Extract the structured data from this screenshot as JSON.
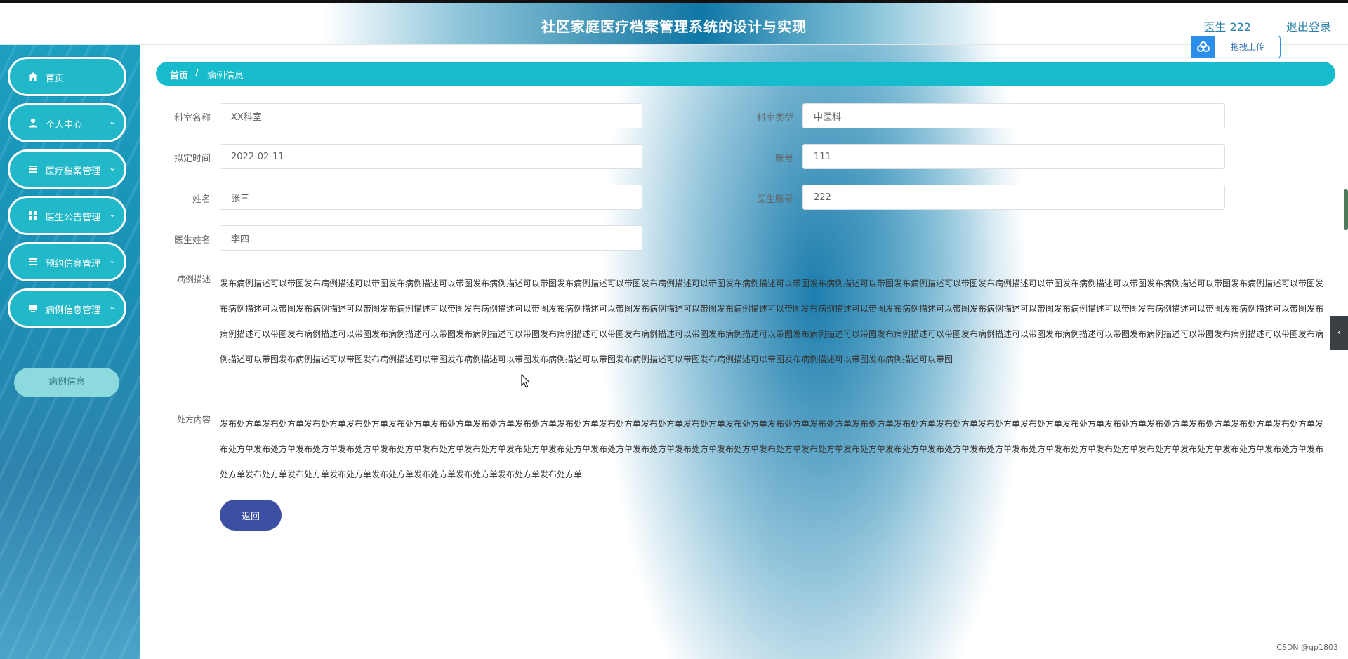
{
  "app": {
    "title": "社区家庭医疗档案管理系统的设计与实现",
    "user_label": "医生 222",
    "logout_label": "退出登录",
    "upload_label": "拖拽上传"
  },
  "sidebar": {
    "items": [
      {
        "label": "首页",
        "icon": "home-icon"
      },
      {
        "label": "个人中心",
        "icon": "user-icon"
      },
      {
        "label": "医疗档案管理",
        "icon": "list-icon"
      },
      {
        "label": "医生公告管理",
        "icon": "grid-icon"
      },
      {
        "label": "预约信息管理",
        "icon": "list-icon"
      },
      {
        "label": "病例信息管理",
        "icon": "folder-icon"
      }
    ],
    "sub_item": "病例信息"
  },
  "breadcrumb": {
    "home": "首页",
    "separator": "/",
    "current": "病例信息"
  },
  "form": {
    "fields": [
      {
        "label": "科室名称",
        "value": "XX科室"
      },
      {
        "label": "科室类型",
        "value": "中医科"
      },
      {
        "label": "拟定时间",
        "value": "2022-02-11"
      },
      {
        "label": "账号",
        "value": "111"
      },
      {
        "label": "姓名",
        "value": "张三"
      },
      {
        "label": "医生账号",
        "value": "222"
      },
      {
        "label": "医生姓名",
        "value": "李四"
      }
    ],
    "description_label": "病例描述",
    "description": "发布病例描述可以带图发布病例描述可以带图发布病例描述可以带图发布病例描述可以带图发布病例描述可以带图发布病例描述可以带图发布病例描述可以带图发布病例描述可以带图发布病例描述可以带图发布病例描述可以带图发布病例描述可以带图发布病例描述可以带图发布病例描述可以带图发布病例描述可以带图发布病例描述可以带图发布病例描述可以带图发布病例描述可以带图发布病例描述可以带图发布病例描述可以带图发布病例描述可以带图发布病例描述可以带图发布病例描述可以带图发布病例描述可以带图发布病例描述可以带图发布病例描述可以带图发布病例描述可以带图发布病例描述可以带图发布病例描述可以带图发布病例描述可以带图发布病例描述可以带图发布病例描述可以带图发布病例描述可以带图发布病例描述可以带图发布病例描述可以带图发布病例描述可以带图发布病例描述可以带图发布病例描述可以带图发布病例描述可以带图发布病例描述可以带图发布病例描述可以带图发布病例描述可以带图发布病例描述可以带图发布病例描述可以带图发布病例描述可以带图发布病例描述可以带图发布病例描述可以带图发布病例描述可以带图发布病例描述可以带图",
    "prescription_label": "处方内容",
    "prescription": "发布处方单发布处方单发布处方单发布处方单发布处方单发布处方单发布处方单发布处方单发布处方单发布处方单发布处方单发布处方单发布处方单发布处方单发布处方单发布处方单发布处方单发布处方单发布处方单发布处方单发布处方单发布处方单发布处方单发布处方单发布处方单发布处方单发布处方单发布处方单发布处方单发布处方单发布处方单发布处方单发布处方单发布处方单发布处方单发布处方单发布处方单发布处方单发布处方单发布处方单发布处方单发布处方单发布处方单发布处方单发布处方单发布处方单发布处方单发布处方单发布处方单发布处方单发布处方单发布处方单发布处方单发布处方单发布处方单发布处方单发布处方单发布处方单发布处方单发布处方单发布处方单",
    "back_label": "返回"
  },
  "side_tab_icon": "chevron-left-icon",
  "watermark": "CSDN @gp1803"
}
